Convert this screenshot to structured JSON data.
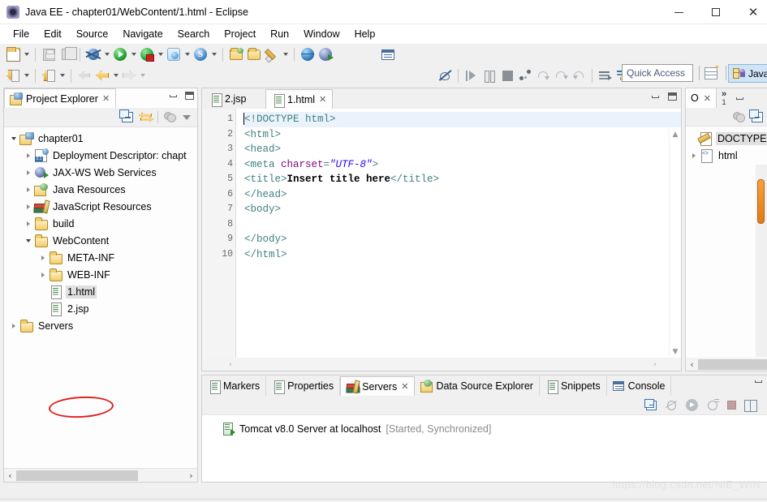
{
  "window": {
    "title": "Java EE - chapter01/WebContent/1.html - Eclipse",
    "app_icon": "eclipse-icon",
    "minimize_label": "–",
    "maximize_label": "□",
    "close_label": "✕"
  },
  "menubar": {
    "items": [
      {
        "label": "File"
      },
      {
        "label": "Edit"
      },
      {
        "label": "Source"
      },
      {
        "label": "Navigate"
      },
      {
        "label": "Search"
      },
      {
        "label": "Project"
      },
      {
        "label": "Run"
      },
      {
        "label": "Window"
      },
      {
        "label": "Help"
      }
    ]
  },
  "toolbar": {
    "row1": [
      {
        "name": "new-wizard-icon",
        "has_arrow": true
      },
      {
        "name": "save-icon",
        "has_arrow": false
      },
      {
        "name": "save-all-icon",
        "has_arrow": false
      },
      {
        "name": "debug-icon",
        "has_arrow": true
      },
      {
        "name": "run-icon",
        "has_arrow": true
      },
      {
        "name": "run-on-server-icon",
        "has_arrow": true
      },
      {
        "name": "new-server-icon",
        "has_arrow": true
      },
      {
        "name": "struts-icon",
        "has_arrow": true
      },
      {
        "name": "open-package-icon",
        "has_arrow": false
      },
      {
        "name": "open-folder-icon",
        "has_arrow": false
      },
      {
        "name": "search-pen-icon",
        "has_arrow": true
      },
      {
        "name": "open-web-browser-icon",
        "has_arrow": false
      },
      {
        "name": "deploy-icon",
        "has_arrow": false
      }
    ],
    "row2_left": [
      {
        "name": "import-icon",
        "has_arrow": true
      },
      {
        "name": "export-icon",
        "has_arrow": true
      },
      {
        "name": "back-history-icon",
        "has_arrow": false
      },
      {
        "name": "back-icon",
        "has_arrow": true
      },
      {
        "name": "forward-icon",
        "has_arrow": true
      }
    ],
    "row1_right": [
      {
        "name": "toggle-view-icon"
      }
    ],
    "row2_right": [
      {
        "name": "skip-all-breakpoints-icon"
      },
      {
        "name": "resume-icon"
      },
      {
        "name": "suspend-icon"
      },
      {
        "name": "terminate-icon"
      },
      {
        "name": "disconnect-icon"
      },
      {
        "name": "step-into-icon"
      },
      {
        "name": "step-over-icon"
      },
      {
        "name": "step-return-icon"
      },
      {
        "name": "show-lines-icon"
      },
      {
        "name": "next-annotation-icon"
      }
    ]
  },
  "quick_access": {
    "placeholder": "Quick Access",
    "value": "Quick Access"
  },
  "perspective": {
    "open_perspective_icon": "open-perspective-icon",
    "active_label": "Java E",
    "active_icon": "java-ee-perspective-icon"
  },
  "project_explorer": {
    "tab_label": "Project Explorer",
    "tab_icon": "project-explorer-icon",
    "tab_close": "✕",
    "minimize_label": "minimize",
    "maximize_label": "maximize",
    "toolbar": [
      {
        "name": "collapse-all-icon"
      },
      {
        "name": "link-with-editor-icon"
      },
      {
        "name": "view-filters-icon"
      },
      {
        "name": "view-menu-icon"
      }
    ],
    "tree": [
      {
        "label": "chapter01",
        "icon": "project-icon",
        "indent": 0,
        "state": "open",
        "selected": false
      },
      {
        "label": "Deployment Descriptor: chapt",
        "icon": "deployment-descriptor-icon",
        "indent": 1,
        "state": "closed",
        "selected": false
      },
      {
        "label": "JAX-WS Web Services",
        "icon": "jaxws-icon",
        "indent": 1,
        "state": "closed",
        "selected": false
      },
      {
        "label": "Java Resources",
        "icon": "java-resources-icon",
        "indent": 1,
        "state": "closed",
        "selected": false
      },
      {
        "label": "JavaScript Resources",
        "icon": "javascript-resources-icon",
        "indent": 1,
        "state": "closed",
        "selected": false
      },
      {
        "label": "build",
        "icon": "folder-icon",
        "indent": 1,
        "state": "closed",
        "selected": false
      },
      {
        "label": "WebContent",
        "icon": "folder-icon",
        "indent": 1,
        "state": "open",
        "selected": false
      },
      {
        "label": "META-INF",
        "icon": "folder-icon",
        "indent": 2,
        "state": "closed",
        "selected": false
      },
      {
        "label": "WEB-INF",
        "icon": "folder-icon",
        "indent": 2,
        "state": "closed",
        "selected": false
      },
      {
        "label": "1.html",
        "icon": "html-file-icon",
        "indent": 2,
        "state": "leaf",
        "selected": true
      },
      {
        "label": "2.jsp",
        "icon": "jsp-file-icon",
        "indent": 2,
        "state": "leaf",
        "selected": false
      },
      {
        "label": "Servers",
        "icon": "folder-icon",
        "indent": 0,
        "state": "closed",
        "selected": false
      }
    ],
    "annotation": {
      "type": "red-circle",
      "target": "1.html",
      "color": "#e02020"
    },
    "hscroll": {
      "left_arrow": "‹",
      "right_arrow": "›"
    }
  },
  "editor": {
    "tabs": [
      {
        "label": "2.jsp",
        "icon": "jsp-file-icon",
        "active": false,
        "close": ""
      },
      {
        "label": "1.html",
        "icon": "html-file-icon",
        "active": true,
        "close": "✕"
      }
    ],
    "actions": [
      {
        "name": "minimize-icon"
      },
      {
        "name": "maximize-icon"
      }
    ],
    "lines": [
      {
        "number": "1",
        "fold": false,
        "current": true,
        "tokens": [
          {
            "t": "&lt;!DOCTYPE html&gt;",
            "c": "t-dt"
          }
        ]
      },
      {
        "number": "2",
        "fold": true,
        "current": false,
        "tokens": [
          {
            "t": "&lt;html&gt;",
            "c": "t-tag"
          }
        ]
      },
      {
        "number": "3",
        "fold": true,
        "current": false,
        "tokens": [
          {
            "t": "&lt;head&gt;",
            "c": "t-tag"
          }
        ]
      },
      {
        "number": "4",
        "fold": false,
        "current": false,
        "tokens": [
          {
            "t": "&lt;meta ",
            "c": "t-tag"
          },
          {
            "t": "charset",
            "c": "t-attr"
          },
          {
            "t": "=",
            "c": "t-tag"
          },
          {
            "t": "\"UTF-8\"",
            "c": "t-val"
          },
          {
            "t": "&gt;",
            "c": "t-tag"
          }
        ]
      },
      {
        "number": "5",
        "fold": false,
        "current": false,
        "tokens": [
          {
            "t": "&lt;title&gt;",
            "c": "t-tag"
          },
          {
            "t": "Insert title here",
            "c": "t-txt"
          },
          {
            "t": "&lt;/title&gt;",
            "c": "t-tag"
          }
        ]
      },
      {
        "number": "6",
        "fold": false,
        "current": false,
        "tokens": [
          {
            "t": "&lt;/head&gt;",
            "c": "t-tag"
          }
        ]
      },
      {
        "number": "7",
        "fold": true,
        "current": false,
        "tokens": [
          {
            "t": "&lt;body&gt;",
            "c": "t-tag"
          }
        ]
      },
      {
        "number": "8",
        "fold": false,
        "current": false,
        "tokens": []
      },
      {
        "number": "9",
        "fold": false,
        "current": false,
        "tokens": [
          {
            "t": "&lt;/body&gt;",
            "c": "t-tag"
          }
        ]
      },
      {
        "number": "10",
        "fold": false,
        "current": false,
        "tokens": [
          {
            "t": "&lt;/html&gt;",
            "c": "t-tag"
          }
        ]
      }
    ],
    "scroll": {
      "up_arrow": "▲",
      "down_arrow": "▼",
      "left_arrow": "‹",
      "right_arrow": "›"
    }
  },
  "outline": {
    "tab_label": "O",
    "tab_icon": "outline-icon",
    "tab_close": "✕",
    "overflow_chevron": "»",
    "overflow_count": "1",
    "minimize_label": "minimize",
    "toolbar": [
      {
        "name": "view-filters-icon"
      },
      {
        "name": "collapse-all-icon"
      }
    ],
    "tree": [
      {
        "label": "DOCTYPE",
        "icon": "doctype-icon",
        "state": "leaf",
        "selected": true
      },
      {
        "label": "html",
        "icon": "html-tag-icon",
        "state": "closed",
        "selected": false
      }
    ]
  },
  "bottom_panel": {
    "tabs": [
      {
        "label": "Markers",
        "icon": "markers-icon",
        "active": false,
        "close": ""
      },
      {
        "label": "Properties",
        "icon": "properties-icon",
        "active": false,
        "close": ""
      },
      {
        "label": "Servers",
        "icon": "servers-icon",
        "active": true,
        "close": "✕"
      },
      {
        "label": "Data Source Explorer",
        "icon": "data-source-explorer-icon",
        "active": false,
        "close": ""
      },
      {
        "label": "Snippets",
        "icon": "snippets-icon",
        "active": false,
        "close": ""
      },
      {
        "label": "Console",
        "icon": "console-icon",
        "active": false,
        "close": ""
      }
    ],
    "actions": [
      {
        "name": "minimize-icon"
      }
    ],
    "toolbar": [
      {
        "name": "collapse-all-icon"
      },
      {
        "name": "debug-server-icon"
      },
      {
        "name": "start-server-icon"
      },
      {
        "name": "profile-server-icon"
      },
      {
        "name": "stop-server-icon"
      },
      {
        "name": "publish-server-icon"
      }
    ],
    "servers": [
      {
        "name": "Tomcat v8.0 Server at localhost",
        "status": "[Started, Synchronized]",
        "icon": "tomcat-server-icon"
      }
    ]
  },
  "watermark": {
    "text": "https://blog.csdn.net/NIE_WIN"
  },
  "colors": {
    "tag": "#3f7f7f",
    "attribute": "#7f007f",
    "value": "#2a00ff",
    "selection": "#e0e0e0",
    "current_line": "#eaf2fb",
    "annotation": "#e02020",
    "perspective_active": "#cfe4f7"
  }
}
